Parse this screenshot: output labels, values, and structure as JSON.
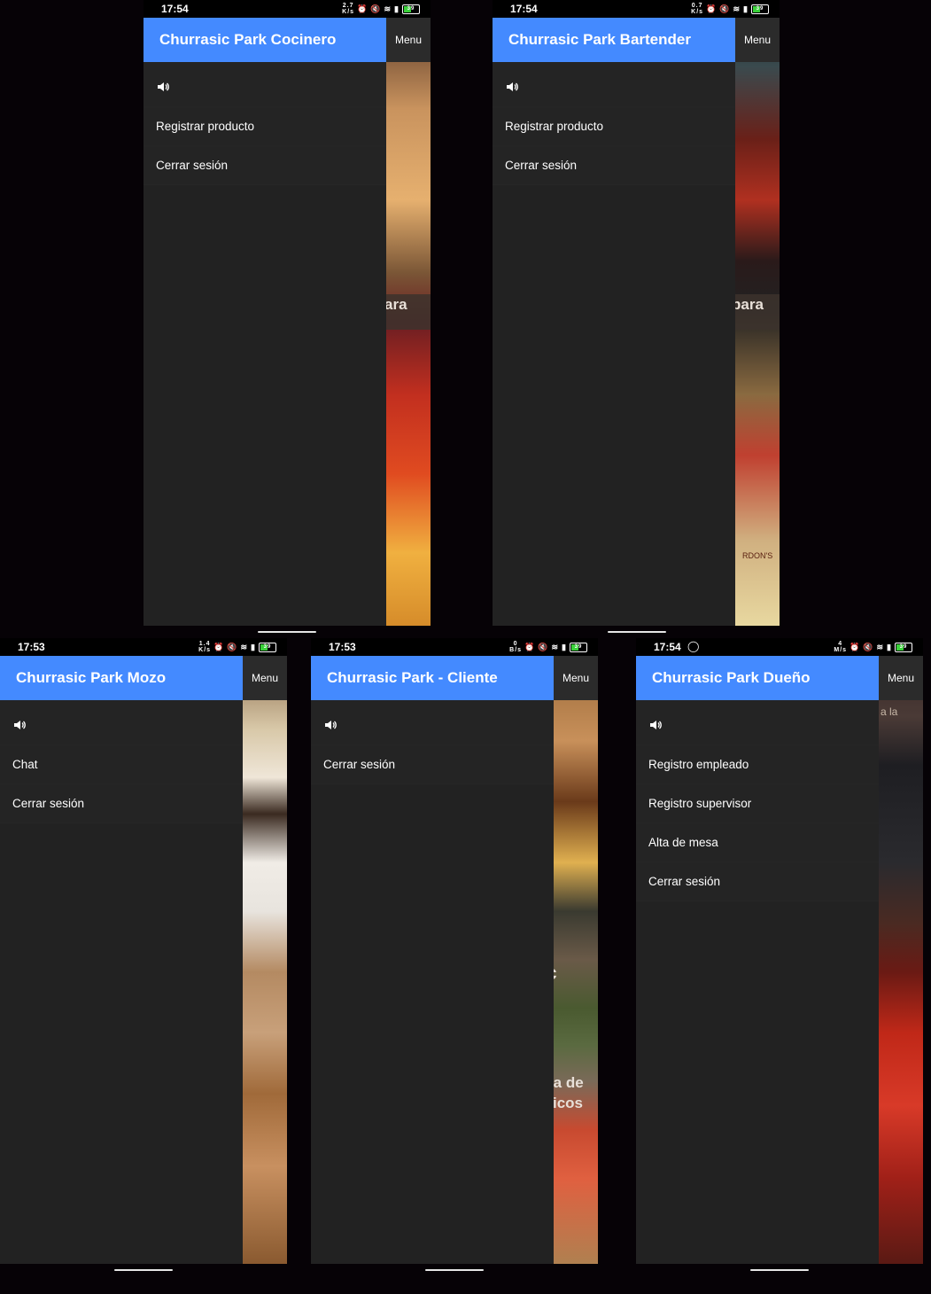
{
  "screens": [
    {
      "time": "17:54",
      "speed_top": "2.7",
      "speed_bottom": "K/s",
      "battery": "39",
      "title": "Churrasic Park Cocinero",
      "menu_label": "Menu",
      "bg_text": "ara",
      "items": [
        "Registrar producto",
        "Cerrar sesión"
      ],
      "speaker_icon": "speaker-icon"
    },
    {
      "time": "17:54",
      "speed_top": "0.7",
      "speed_bottom": "K/s",
      "battery": "39",
      "title": "Churrasic Park Bartender",
      "menu_label": "Menu",
      "bg_text": "para",
      "bg_label": "RDON'S",
      "items": [
        "Registrar producto",
        "Cerrar sesión"
      ],
      "speaker_icon": "speaker-icon"
    },
    {
      "time": "17:53",
      "speed_top": "1.4",
      "speed_bottom": "K/s",
      "battery": "39",
      "title": "Churrasic Park Mozo",
      "menu_label": "Menu",
      "items": [
        "Chat",
        "Cerrar sesión"
      ],
      "speaker_icon": "speaker-icon"
    },
    {
      "time": "17:53",
      "speed_top": "0",
      "speed_bottom": "B/s",
      "battery": "39",
      "title": "Churrasic Park - Cliente",
      "menu_label": "Menu",
      "bg_text_1": "sic",
      "bg_text_2": "ta de",
      "bg_text_3": "icos",
      "items": [
        "Cerrar sesión"
      ],
      "speaker_icon": "speaker-icon"
    },
    {
      "time": "17:54",
      "speed_top": "4",
      "speed_bottom": "M/s",
      "battery": "39",
      "title": "Churrasic Park Dueño",
      "menu_label": "Menu",
      "bg_text": "a la",
      "items": [
        "Registro empleado",
        "Registro supervisor",
        "Alta de mesa",
        "Cerrar sesión"
      ],
      "speaker_icon": "speaker-icon",
      "whatsapp_icon": "whatsapp-icon"
    }
  ]
}
